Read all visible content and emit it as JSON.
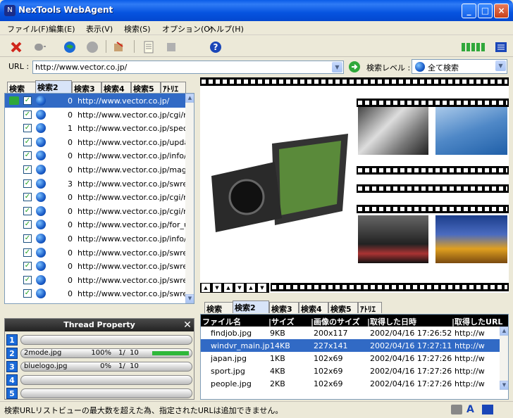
{
  "window": {
    "title": "NexTools WebAgent",
    "icon_text": "N"
  },
  "menu": [
    "ファイル(F)",
    "編集(E)",
    "表示(V)",
    "検索(S)",
    "オプション(O)",
    "ヘルプ(H)"
  ],
  "urlbar": {
    "label": "URL :",
    "value": "http://www.vector.co.jp/",
    "level_label": "検索レベル :",
    "level_value": "全て検索"
  },
  "search_tabs": [
    "検索",
    "検索2",
    "検索3",
    "検索4",
    "検索5",
    "ｱﾄﾘｴ"
  ],
  "url_list": [
    {
      "count": "0",
      "url": "http://www.vector.co.jp/"
    },
    {
      "count": "0",
      "url": "http://www.vector.co.jp/cgi/n"
    },
    {
      "count": "1",
      "url": "http://www.vector.co.jp/speci"
    },
    {
      "count": "0",
      "url": "http://www.vector.co.jp/updat"
    },
    {
      "count": "0",
      "url": "http://www.vector.co.jp/info/"
    },
    {
      "count": "0",
      "url": "http://www.vector.co.jp/maga"
    },
    {
      "count": "3",
      "url": "http://www.vector.co.jp/swree"
    },
    {
      "count": "0",
      "url": "http://www.vector.co.jp/cgi/n"
    },
    {
      "count": "0",
      "url": "http://www.vector.co.jp/cgi/n"
    },
    {
      "count": "0",
      "url": "http://www.vector.co.jp/for_us"
    },
    {
      "count": "0",
      "url": "http://www.vector.co.jp/info/s"
    },
    {
      "count": "0",
      "url": "http://www.vector.co.jp/swree"
    },
    {
      "count": "0",
      "url": "http://www.vector.co.jp/swree"
    },
    {
      "count": "0",
      "url": "http://www.vector.co.jp/swree"
    },
    {
      "count": "0",
      "url": "http://www.vector.co.jp/swree"
    }
  ],
  "thread": {
    "title": "Thread Property",
    "rows": [
      {
        "num": "1",
        "file": "",
        "pct": "",
        "count": "",
        "progress": 0
      },
      {
        "num": "2",
        "file": "2mode.jpg",
        "pct": "100%",
        "count": "1/  10",
        "progress": 100
      },
      {
        "num": "3",
        "file": "bluelogo.jpg",
        "pct": "0%",
        "count": "1/  10",
        "progress": 0
      },
      {
        "num": "4",
        "file": "",
        "pct": "",
        "count": "",
        "progress": 0
      },
      {
        "num": "5",
        "file": "",
        "pct": "",
        "count": "",
        "progress": 0
      }
    ]
  },
  "file_table": {
    "headers": [
      "ファイル名",
      "|サイズ",
      "|画像のサイズ",
      "|取得した日時",
      "|取得したURL"
    ],
    "rows": [
      {
        "name": "findjob.jpg",
        "size": "9KB",
        "dim": "200x117",
        "date": "2002/04/16 17:26:52",
        "url": "http://w"
      },
      {
        "name": "windvr_main.jpg",
        "size": "14KB",
        "dim": "227x141",
        "date": "2002/04/16 17:27:11",
        "url": "http://w"
      },
      {
        "name": "japan.jpg",
        "size": "1KB",
        "dim": "102x69",
        "date": "2002/04/16 17:27:26",
        "url": "http://w"
      },
      {
        "name": "sport.jpg",
        "size": "4KB",
        "dim": "102x69",
        "date": "2002/04/16 17:27:26",
        "url": "http://w"
      },
      {
        "name": "people.jpg",
        "size": "2KB",
        "dim": "102x69",
        "date": "2002/04/16 17:27:26",
        "url": "http://w"
      }
    ]
  },
  "status": "検索URLリストビューの最大数を超えた為、指定されたURLは追加できません。",
  "colors": {
    "selection": "#316ac5",
    "titlebar": "#0a5ce8"
  }
}
